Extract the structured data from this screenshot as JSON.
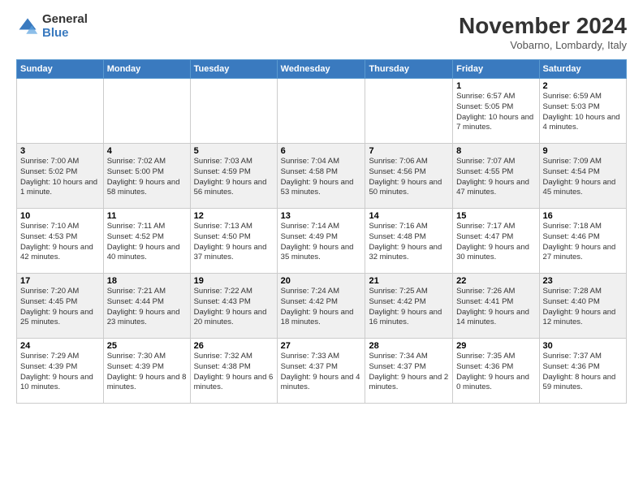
{
  "logo": {
    "general": "General",
    "blue": "Blue"
  },
  "header": {
    "month": "November 2024",
    "location": "Vobarno, Lombardy, Italy"
  },
  "weekdays": [
    "Sunday",
    "Monday",
    "Tuesday",
    "Wednesday",
    "Thursday",
    "Friday",
    "Saturday"
  ],
  "rows": [
    [
      {
        "day": "",
        "info": ""
      },
      {
        "day": "",
        "info": ""
      },
      {
        "day": "",
        "info": ""
      },
      {
        "day": "",
        "info": ""
      },
      {
        "day": "",
        "info": ""
      },
      {
        "day": "1",
        "info": "Sunrise: 6:57 AM\nSunset: 5:05 PM\nDaylight: 10 hours and 7 minutes."
      },
      {
        "day": "2",
        "info": "Sunrise: 6:59 AM\nSunset: 5:03 PM\nDaylight: 10 hours and 4 minutes."
      }
    ],
    [
      {
        "day": "3",
        "info": "Sunrise: 7:00 AM\nSunset: 5:02 PM\nDaylight: 10 hours and 1 minute."
      },
      {
        "day": "4",
        "info": "Sunrise: 7:02 AM\nSunset: 5:00 PM\nDaylight: 9 hours and 58 minutes."
      },
      {
        "day": "5",
        "info": "Sunrise: 7:03 AM\nSunset: 4:59 PM\nDaylight: 9 hours and 56 minutes."
      },
      {
        "day": "6",
        "info": "Sunrise: 7:04 AM\nSunset: 4:58 PM\nDaylight: 9 hours and 53 minutes."
      },
      {
        "day": "7",
        "info": "Sunrise: 7:06 AM\nSunset: 4:56 PM\nDaylight: 9 hours and 50 minutes."
      },
      {
        "day": "8",
        "info": "Sunrise: 7:07 AM\nSunset: 4:55 PM\nDaylight: 9 hours and 47 minutes."
      },
      {
        "day": "9",
        "info": "Sunrise: 7:09 AM\nSunset: 4:54 PM\nDaylight: 9 hours and 45 minutes."
      }
    ],
    [
      {
        "day": "10",
        "info": "Sunrise: 7:10 AM\nSunset: 4:53 PM\nDaylight: 9 hours and 42 minutes."
      },
      {
        "day": "11",
        "info": "Sunrise: 7:11 AM\nSunset: 4:52 PM\nDaylight: 9 hours and 40 minutes."
      },
      {
        "day": "12",
        "info": "Sunrise: 7:13 AM\nSunset: 4:50 PM\nDaylight: 9 hours and 37 minutes."
      },
      {
        "day": "13",
        "info": "Sunrise: 7:14 AM\nSunset: 4:49 PM\nDaylight: 9 hours and 35 minutes."
      },
      {
        "day": "14",
        "info": "Sunrise: 7:16 AM\nSunset: 4:48 PM\nDaylight: 9 hours and 32 minutes."
      },
      {
        "day": "15",
        "info": "Sunrise: 7:17 AM\nSunset: 4:47 PM\nDaylight: 9 hours and 30 minutes."
      },
      {
        "day": "16",
        "info": "Sunrise: 7:18 AM\nSunset: 4:46 PM\nDaylight: 9 hours and 27 minutes."
      }
    ],
    [
      {
        "day": "17",
        "info": "Sunrise: 7:20 AM\nSunset: 4:45 PM\nDaylight: 9 hours and 25 minutes."
      },
      {
        "day": "18",
        "info": "Sunrise: 7:21 AM\nSunset: 4:44 PM\nDaylight: 9 hours and 23 minutes."
      },
      {
        "day": "19",
        "info": "Sunrise: 7:22 AM\nSunset: 4:43 PM\nDaylight: 9 hours and 20 minutes."
      },
      {
        "day": "20",
        "info": "Sunrise: 7:24 AM\nSunset: 4:42 PM\nDaylight: 9 hours and 18 minutes."
      },
      {
        "day": "21",
        "info": "Sunrise: 7:25 AM\nSunset: 4:42 PM\nDaylight: 9 hours and 16 minutes."
      },
      {
        "day": "22",
        "info": "Sunrise: 7:26 AM\nSunset: 4:41 PM\nDaylight: 9 hours and 14 minutes."
      },
      {
        "day": "23",
        "info": "Sunrise: 7:28 AM\nSunset: 4:40 PM\nDaylight: 9 hours and 12 minutes."
      }
    ],
    [
      {
        "day": "24",
        "info": "Sunrise: 7:29 AM\nSunset: 4:39 PM\nDaylight: 9 hours and 10 minutes."
      },
      {
        "day": "25",
        "info": "Sunrise: 7:30 AM\nSunset: 4:39 PM\nDaylight: 9 hours and 8 minutes."
      },
      {
        "day": "26",
        "info": "Sunrise: 7:32 AM\nSunset: 4:38 PM\nDaylight: 9 hours and 6 minutes."
      },
      {
        "day": "27",
        "info": "Sunrise: 7:33 AM\nSunset: 4:37 PM\nDaylight: 9 hours and 4 minutes."
      },
      {
        "day": "28",
        "info": "Sunrise: 7:34 AM\nSunset: 4:37 PM\nDaylight: 9 hours and 2 minutes."
      },
      {
        "day": "29",
        "info": "Sunrise: 7:35 AM\nSunset: 4:36 PM\nDaylight: 9 hours and 0 minutes."
      },
      {
        "day": "30",
        "info": "Sunrise: 7:37 AM\nSunset: 4:36 PM\nDaylight: 8 hours and 59 minutes."
      }
    ]
  ]
}
